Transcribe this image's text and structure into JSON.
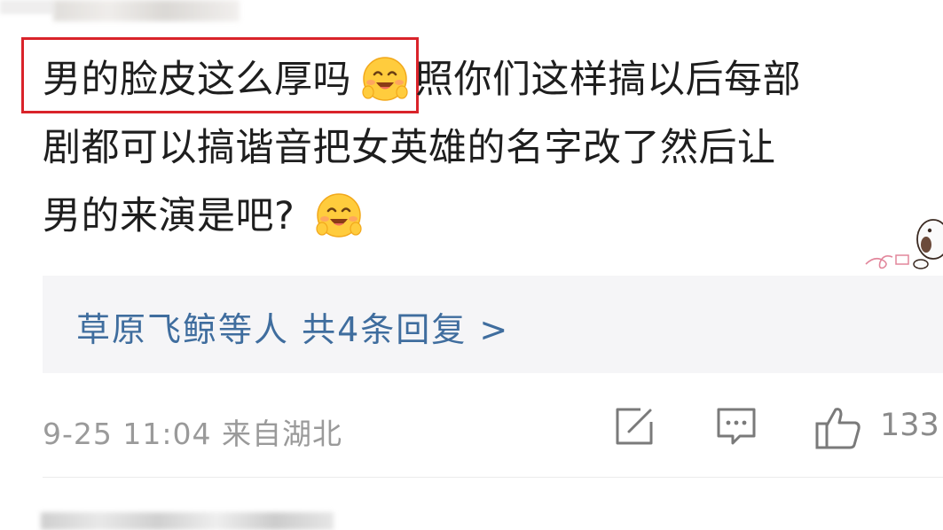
{
  "comment": {
    "line1_highlight": "男的脸皮这么厚吗",
    "line1_rest": "照你们这样搞以后每部",
    "line2": "剧都可以搞谐音把女英雄的名字改了然后让",
    "line3": "男的来演是吧?",
    "emoji": "smiling-face-emoji"
  },
  "replies": {
    "summary": "草原飞鲸等人 共4条回复 >"
  },
  "meta": {
    "time_location": "9-25 11:04 来自湖北"
  },
  "actions": {
    "like_count": "133",
    "share_icon": "share-edit-icon",
    "comment_icon": "comment-bubble-icon",
    "like_icon": "thumbs-up-icon"
  },
  "colors": {
    "highlight_box": "#d9232a",
    "reply_link": "#3f6d9e",
    "meta_text": "#9a9a9a",
    "reply_bg": "#f5f5f7"
  }
}
